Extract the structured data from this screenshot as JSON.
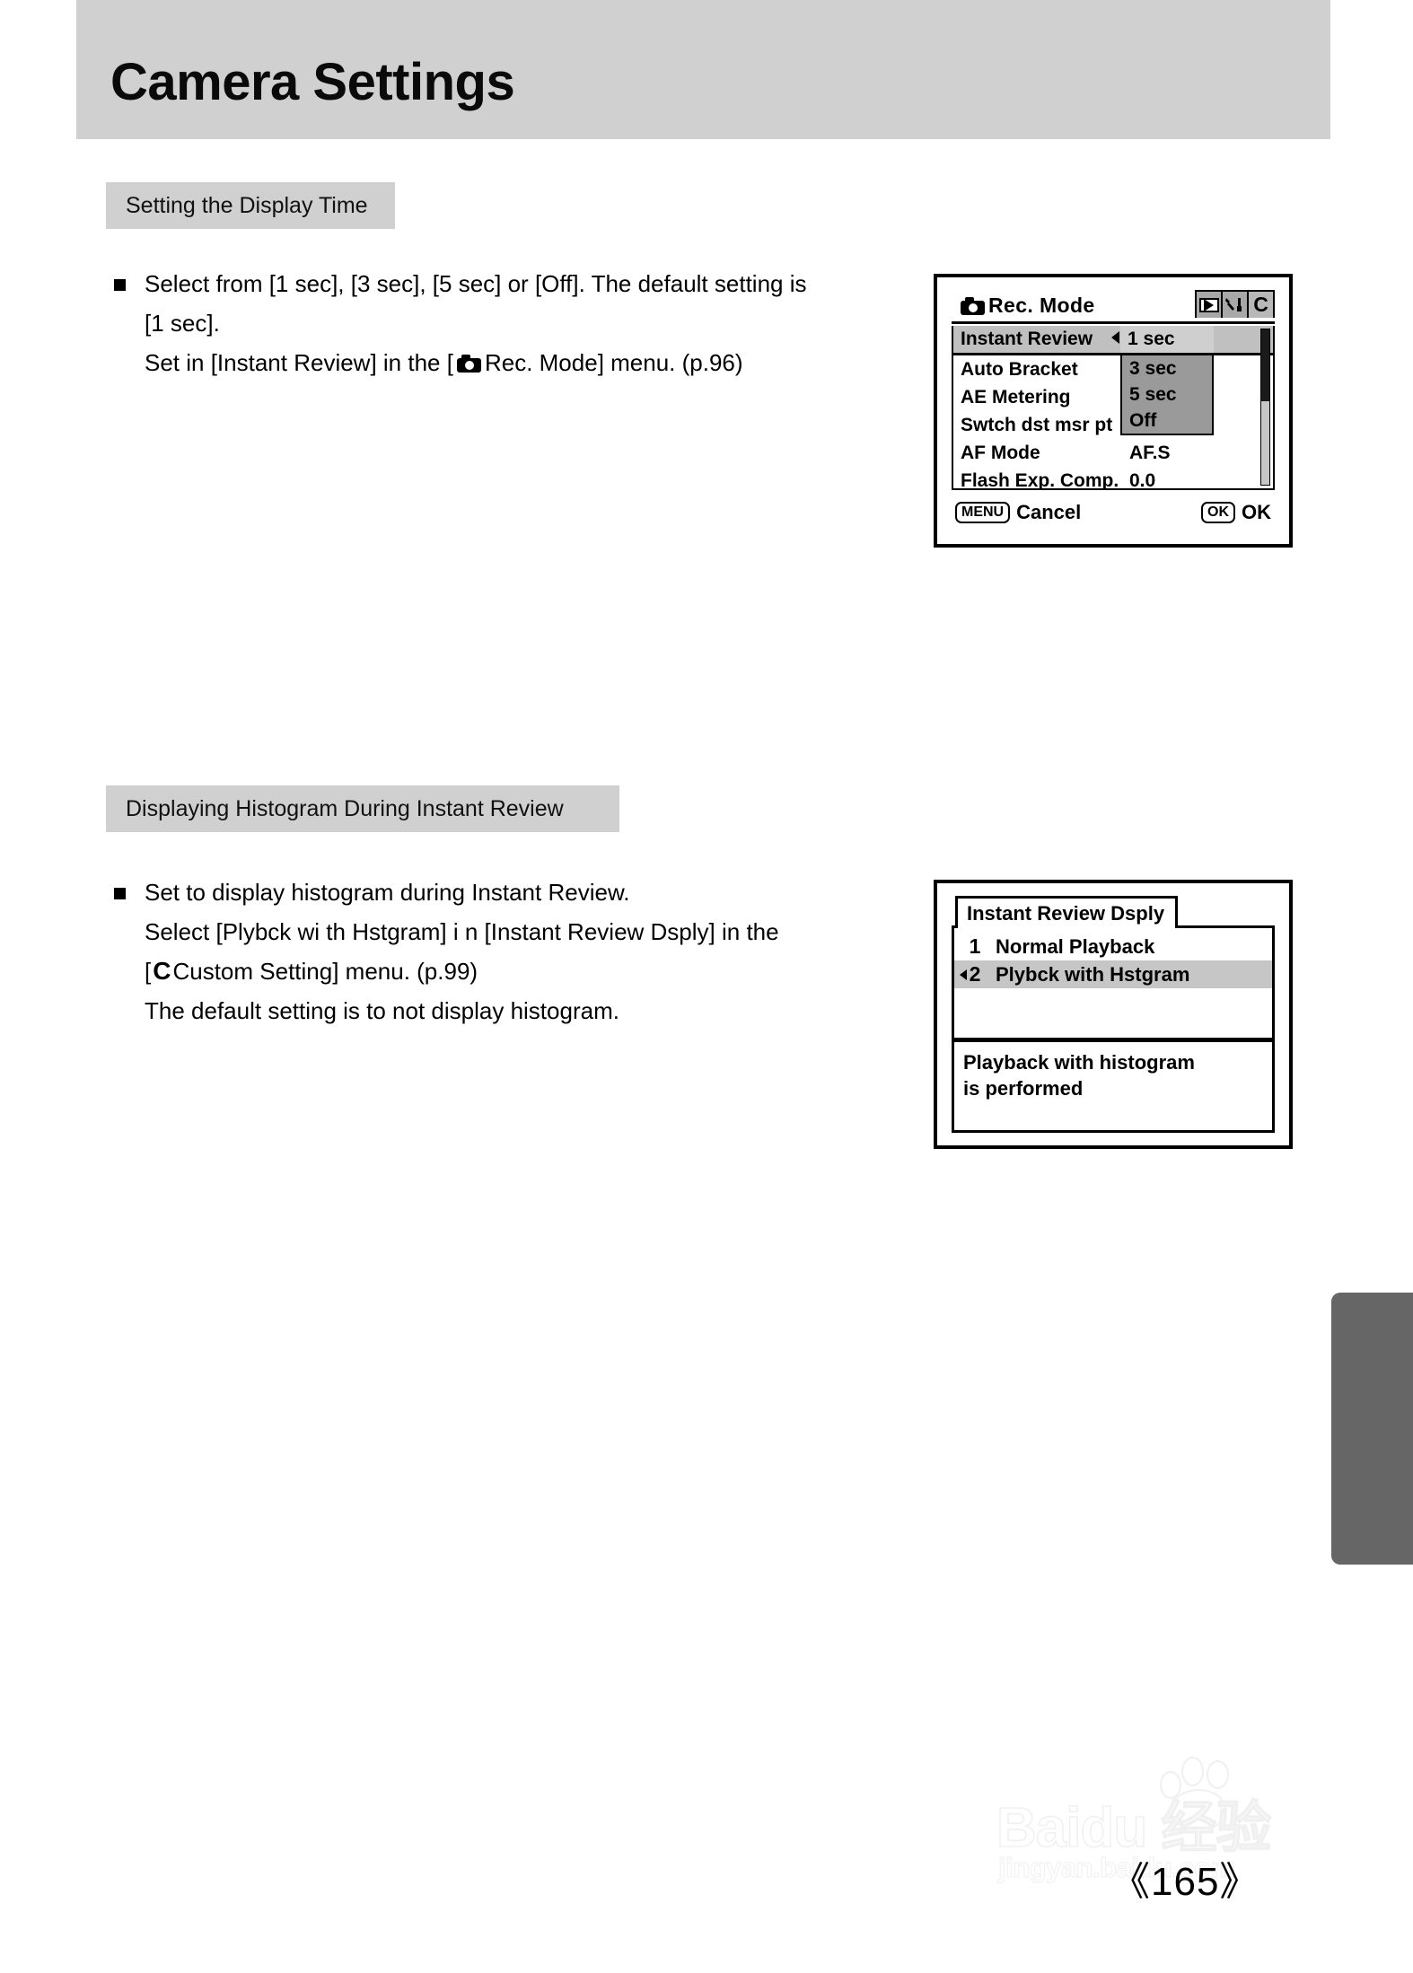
{
  "page": {
    "title": "Camera Settings",
    "number": "《165》"
  },
  "sections": [
    {
      "heading": "Setting the Display Time",
      "body": {
        "line1": "Select from [1 sec], [3 sec], [5 sec] or [Off]. The default setting is",
        "line2": "[1 sec].",
        "line3_a": "Set in [Instant Review] in the [",
        "line3_b": "Rec. Mode] menu. (p.96)"
      }
    },
    {
      "heading": "Displaying Histogram During Instant Review",
      "body": {
        "line1": "Set to display histogram during Instant Review.",
        "line2": "Select [Plybck wi th Hstgram] i n [Instant Review Dsply] in the",
        "line3_a": "[",
        "line3_c": "C",
        "line3_b": "Custom Setting] menu. (p.99)",
        "line4": "The default setting is to not display histogram."
      }
    }
  ],
  "lcd_rec_mode": {
    "title": "Rec. Mode",
    "tabs": [
      "play-icon",
      "tools-icon",
      "C"
    ],
    "rows": [
      {
        "label": "Instant Review",
        "value": "1 sec",
        "selected": true
      },
      {
        "label": "Auto Bracket",
        "value": "",
        "selected": false
      },
      {
        "label": "AE Metering",
        "value": "",
        "selected": false
      },
      {
        "label": "Swtch dst msr pt",
        "value": "",
        "selected": false
      },
      {
        "label": "AF Mode",
        "value": "AF.S",
        "selected": false
      },
      {
        "label": "Flash Exp. Comp.",
        "value": "0.0",
        "selected": false
      }
    ],
    "dropdown": {
      "selected": "1 sec",
      "options": [
        "3 sec",
        "5 sec",
        "Off"
      ]
    },
    "footer": {
      "menu_key": "MENU",
      "menu_label": "Cancel",
      "ok_key": "OK",
      "ok_label": "OK"
    }
  },
  "lcd_instant_review_dsply": {
    "title": "Instant Review Dsply",
    "items": [
      {
        "num": "1",
        "label": "Normal Playback",
        "highlighted": false
      },
      {
        "num": "2",
        "label": "Plybck with Hstgram",
        "highlighted": true
      }
    ],
    "description_line1": "Playback with histogram",
    "description_line2": "is performed"
  },
  "watermark": {
    "main": "Baidu 经验",
    "sub": "jingyan.baidu.com"
  },
  "colors": {
    "band_gray": "#d0d0d0",
    "edge_tab": "#666666",
    "lcd_select": "#c0c0c0",
    "lcd_dropdown": "#9a9a9a"
  }
}
